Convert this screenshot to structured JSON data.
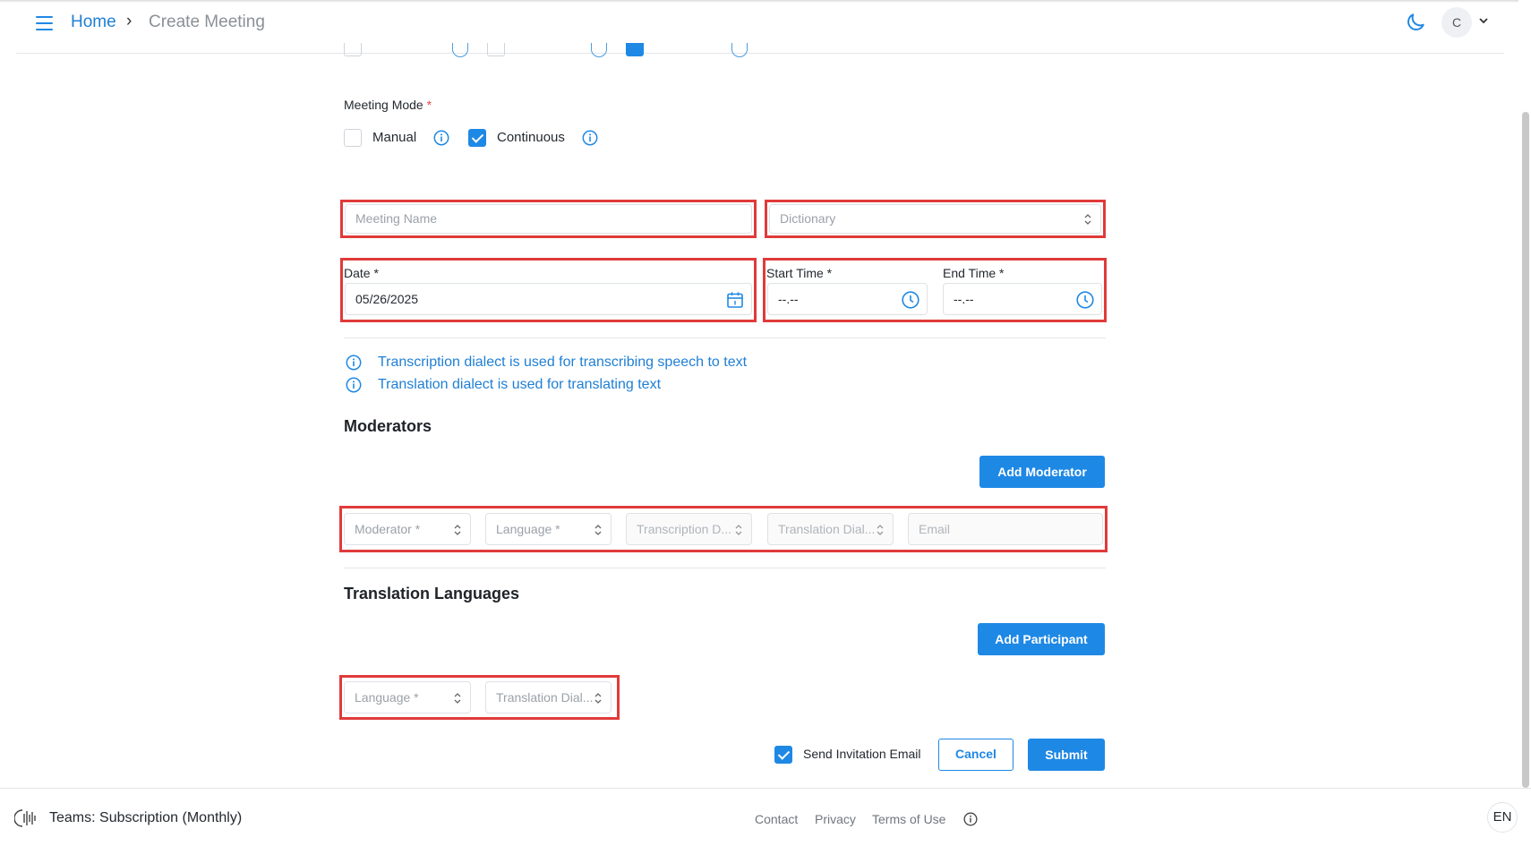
{
  "breadcrumb": {
    "home": "Home",
    "separator": "›",
    "current": "Create Meeting"
  },
  "user": {
    "initial": "C"
  },
  "meeting_mode": {
    "label": "Meeting Mode",
    "required_mark": "*",
    "options": [
      {
        "label": "Manual",
        "checked": false
      },
      {
        "label": "Continuous",
        "checked": true
      }
    ]
  },
  "form": {
    "meeting_name_placeholder": "Meeting Name",
    "dictionary_placeholder": "Dictionary",
    "date_label": "Date *",
    "date_value": "05/26/2025",
    "start_time_label": "Start Time *",
    "start_time_value": "--.--",
    "end_time_label": "End Time *",
    "end_time_value": "--.--"
  },
  "hints": [
    "Transcription dialect is used for transcribing speech to text",
    "Translation dialect is used for translating text"
  ],
  "moderators": {
    "title": "Moderators",
    "add_button": "Add Moderator",
    "fields": {
      "moderator": "Moderator *",
      "language": "Language *",
      "transcription_dialect": "Transcription D...",
      "translation_dialect": "Translation Dial...",
      "email": "Email"
    }
  },
  "translation_languages": {
    "title": "Translation Languages",
    "add_button": "Add Participant",
    "fields": {
      "language": "Language *",
      "translation_dialect": "Translation Dial..."
    }
  },
  "actions": {
    "send_invitation_label": "Send Invitation Email",
    "send_invitation_checked": true,
    "cancel": "Cancel",
    "submit": "Submit"
  },
  "footer": {
    "subscription": "Teams: Subscription (Monthly)",
    "links": [
      "Contact",
      "Privacy",
      "Terms of Use"
    ],
    "language": "EN"
  },
  "colors": {
    "accent": "#1e88e5",
    "link": "#1f7fd4",
    "highlight": "#e03a3a"
  }
}
